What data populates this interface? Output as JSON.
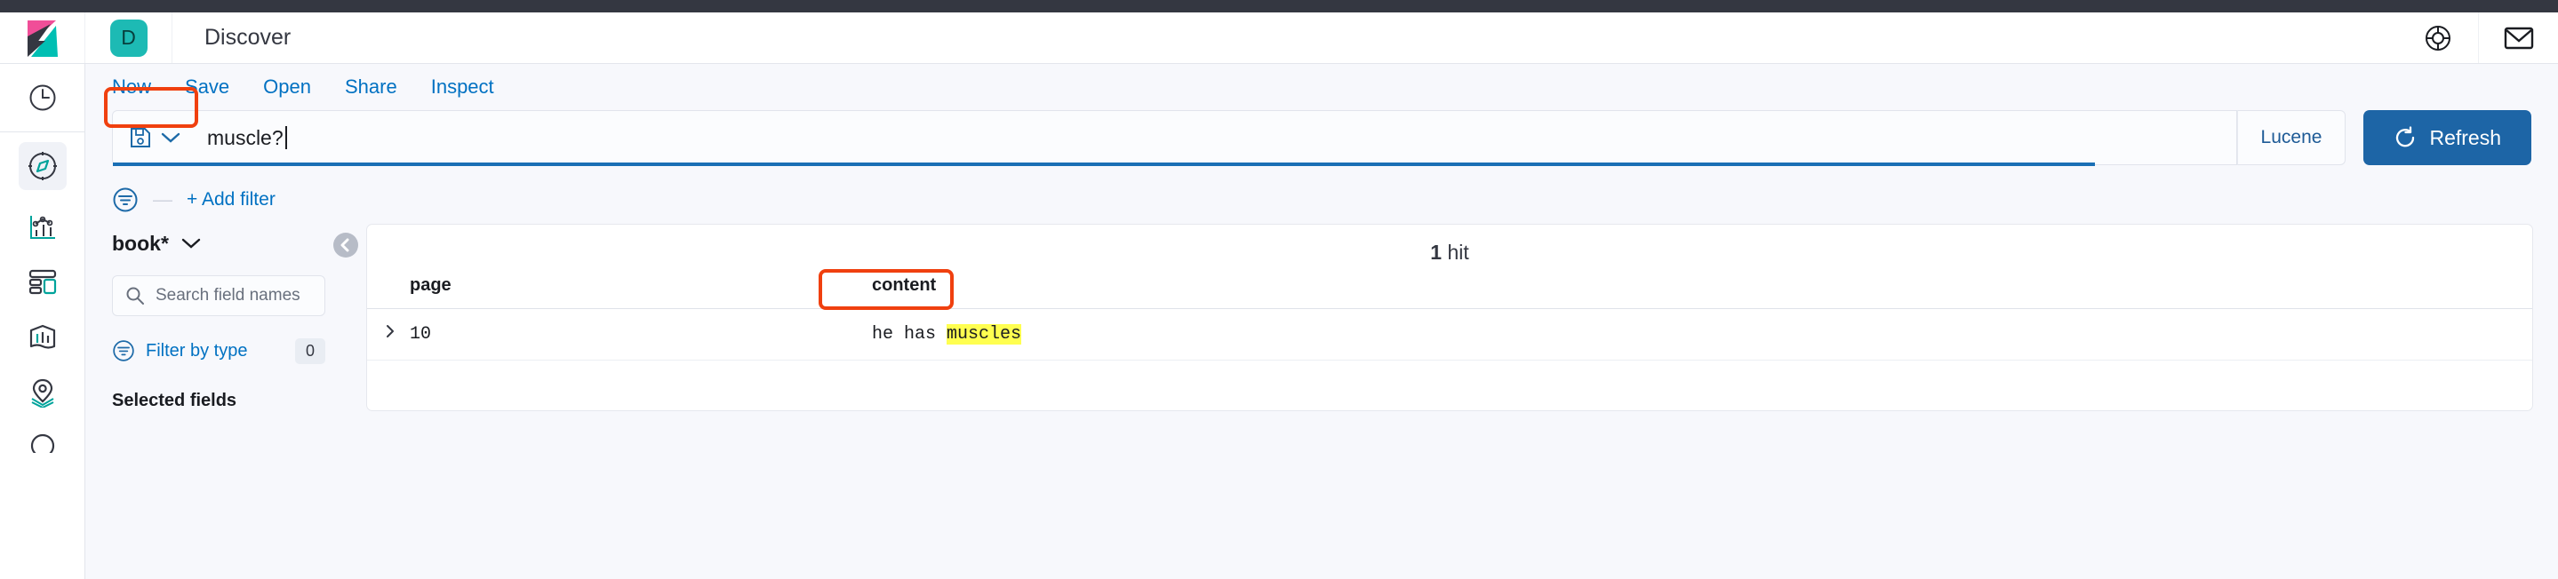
{
  "header": {
    "title": "Discover",
    "space_initial": "D",
    "logo_name": "kibana-logo",
    "actions": [
      {
        "name": "help-icon",
        "label": "Help"
      },
      {
        "name": "mail-icon",
        "label": "Mail"
      }
    ]
  },
  "rail": {
    "items": [
      {
        "name": "recently-viewed-icon",
        "label": "Recently viewed",
        "active": false
      },
      {
        "name": "discover-compass-icon",
        "label": "Discover",
        "active": true
      },
      {
        "name": "visualize-chart-icon",
        "label": "Visualize",
        "active": false
      },
      {
        "name": "dashboard-icon",
        "label": "Dashboard",
        "active": false
      },
      {
        "name": "canvas-icon",
        "label": "Canvas",
        "active": false
      },
      {
        "name": "maps-icon",
        "label": "Maps",
        "active": false
      },
      {
        "name": "machine-learning-icon",
        "label": "Machine Learning",
        "active": false
      }
    ]
  },
  "menu": {
    "items": [
      "New",
      "Save",
      "Open",
      "Share",
      "Inspect"
    ]
  },
  "query_bar": {
    "saved_query_icon": "save-disk-icon",
    "value": "muscle?",
    "placeholder": "Search",
    "language": "Lucene",
    "refresh_label": "Refresh",
    "accent_color": "#1d65a6",
    "focus_underline_color": "#1a6fb5"
  },
  "filters": {
    "filter_icon": "filter-circle-icon",
    "separator": "—",
    "add_filter_label": "+ Add filter"
  },
  "sidebar": {
    "index_pattern": "book*",
    "field_search_placeholder": "Search field names",
    "filter_by_type_label": "Filter by type",
    "filter_by_type_count": "0",
    "selected_fields_label": "Selected fields"
  },
  "results": {
    "hit_count": "1",
    "hit_label": "hit",
    "columns": [
      "page",
      "content"
    ],
    "rows": [
      {
        "page": "10",
        "content_prefix": "he has ",
        "content_highlight": "muscles",
        "content_suffix": ""
      }
    ]
  },
  "annotations": {
    "color": "#f0400f",
    "query_box": "query-input-highlight",
    "content_box": "content-cell-highlight"
  }
}
